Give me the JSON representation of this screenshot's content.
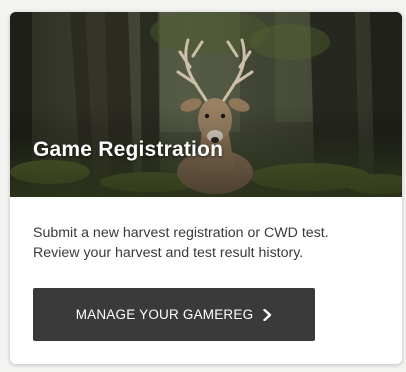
{
  "card": {
    "title": "Game Registration",
    "description_lines": [
      "Submit a new harvest registration or CWD test.",
      "Review your harvest and test result history."
    ],
    "button_label": "MANAGE YOUR GAMEREG",
    "button_icon": "chevron-right-icon"
  },
  "colors": {
    "button_bg": "#3a3a3a",
    "text": "#3a3a3a",
    "title": "#ffffff"
  }
}
